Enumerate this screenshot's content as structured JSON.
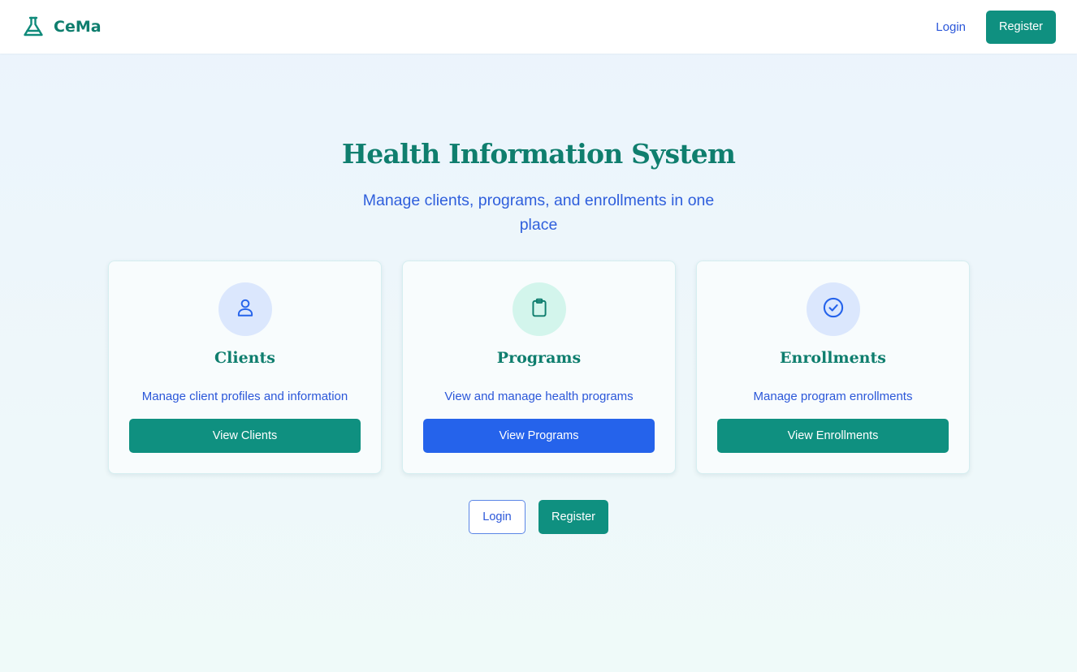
{
  "colors": {
    "primary_teal": "#0f9080",
    "heading_teal": "#0f7e6e",
    "accent_blue": "#2563eb",
    "link_blue": "#2b57d9"
  },
  "navbar": {
    "brand_icon": "flask-icon",
    "brand_name": "CeMa",
    "login_label": "Login",
    "register_label": "Register"
  },
  "hero": {
    "title": "Health Information System",
    "subtitle": "Manage clients, programs, and enrollments in one place"
  },
  "cards": [
    {
      "icon": "user-icon",
      "icon_bg": "#dbe7fd",
      "icon_color": "#2563eb",
      "title": "Clients",
      "description": "Manage client profiles and information",
      "button_label": "View Clients",
      "button_color": "#0f9080"
    },
    {
      "icon": "clipboard-icon",
      "icon_bg": "#d3f5ec",
      "icon_color": "#0f7e6e",
      "title": "Programs",
      "description": "View and manage health programs",
      "button_label": "View Programs",
      "button_color": "#2563eb"
    },
    {
      "icon": "check-circle-icon",
      "icon_bg": "#dbe7fd",
      "icon_color": "#2563eb",
      "title": "Enrollments",
      "description": "Manage program enrollments",
      "button_label": "View Enrollments",
      "button_color": "#0f9080"
    }
  ],
  "bottom": {
    "login_label": "Login",
    "register_label": "Register"
  }
}
